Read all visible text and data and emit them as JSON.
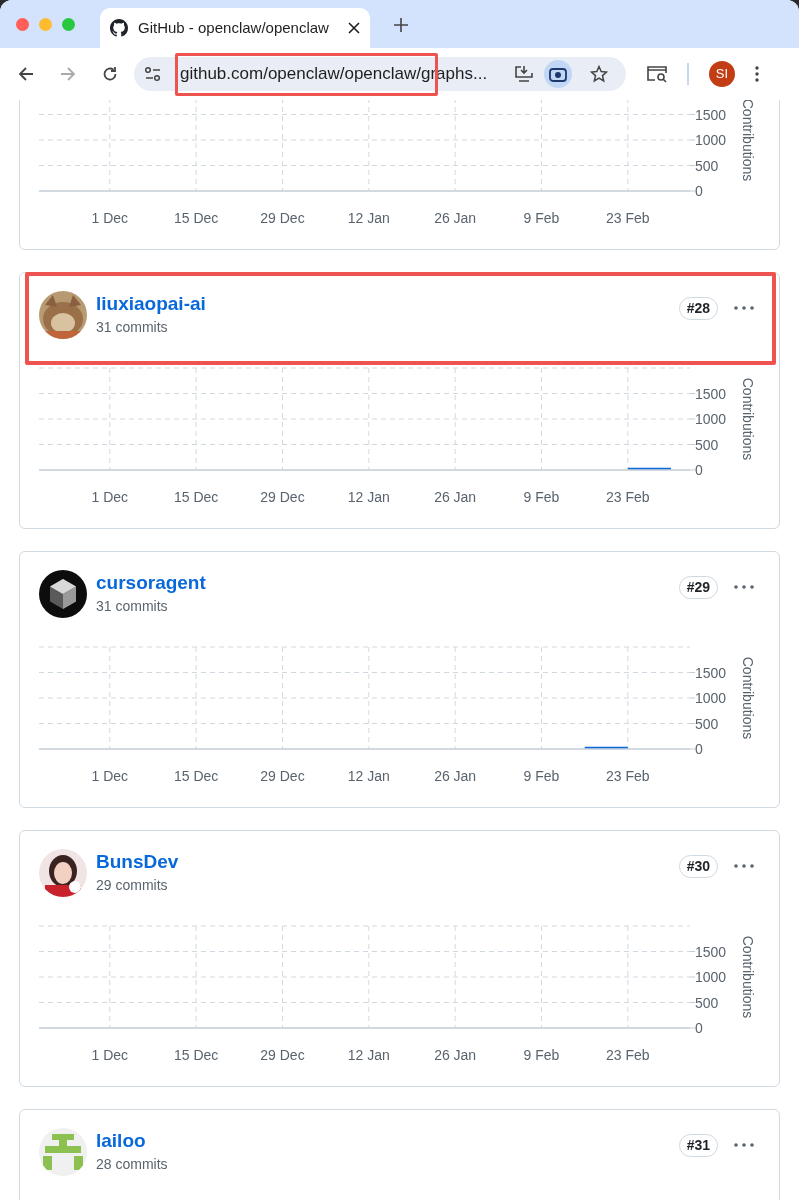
{
  "browser": {
    "tab_title": "GitHub - openclaw/openclaw",
    "url": "github.com/openclaw/openclaw/graphs...",
    "url_highlighted": true,
    "profile": "SI"
  },
  "contributors": [
    {
      "highlighted": false,
      "chart_data": {
        "type": "line",
        "ylabel": "Contributions",
        "grid": true,
        "ylim": [
          0,
          2000
        ],
        "categories": [
          null,
          "1 Dec",
          null,
          "15 Dec",
          null,
          "29 Dec",
          null,
          "12 Jan",
          null,
          "26 Jan",
          null,
          "9 Feb",
          null,
          "23 Feb",
          null
        ],
        "yticks": [
          0,
          500,
          1000,
          1500
        ]
      }
    },
    {
      "name": "liuxiaopai-ai",
      "commits": "31 commits",
      "rank": "#28",
      "highlighted": true,
      "chart_data": {
        "type": "line",
        "ylabel": "Contributions",
        "grid": true,
        "ylim": [
          0,
          2000
        ],
        "categories": [
          null,
          "1 Dec",
          null,
          "15 Dec",
          null,
          "29 Dec",
          null,
          "12 Jan",
          null,
          "26 Jan",
          null,
          "9 Feb",
          null,
          "23 Feb",
          null
        ],
        "yticks": [
          0,
          500,
          1000,
          1500
        ],
        "series": [
          {
            "color": "#0969da",
            "values": [
              null,
              null,
              null,
              null,
              null,
              null,
              null,
              null,
              null,
              null,
              null,
              null,
              null,
              10,
              10
            ]
          }
        ]
      }
    },
    {
      "name": "cursoragent",
      "commits": "31 commits",
      "rank": "#29",
      "kind": "logo",
      "highlighted": false,
      "chart_data": {
        "type": "line",
        "ylabel": "Contributions",
        "grid": true,
        "ylim": [
          0,
          2000
        ],
        "categories": [
          null,
          "1 Dec",
          null,
          "15 Dec",
          null,
          "29 Dec",
          null,
          "12 Jan",
          null,
          "26 Jan",
          null,
          "9 Feb",
          null,
          "23 Feb",
          null
        ],
        "yticks": [
          0,
          500,
          1000,
          1500
        ],
        "series": [
          {
            "color": "#0969da",
            "values": [
              null,
              null,
              null,
              null,
              null,
              null,
              null,
              null,
              null,
              null,
              null,
              null,
              10,
              10,
              null
            ]
          }
        ]
      }
    },
    {
      "name": "BunsDev",
      "commits": "29 commits",
      "rank": "#30",
      "highlighted": false,
      "chart_data": {
        "type": "line",
        "ylabel": "Contributions",
        "grid": true,
        "ylim": [
          0,
          2000
        ],
        "categories": [
          null,
          "1 Dec",
          null,
          "15 Dec",
          null,
          "29 Dec",
          null,
          "12 Jan",
          null,
          "26 Jan",
          null,
          "9 Feb",
          null,
          "23 Feb",
          null
        ],
        "yticks": [
          0,
          500,
          1000,
          1500
        ]
      }
    },
    {
      "name": "lailoo",
      "commits": "28 commits",
      "rank": "#31",
      "kind": "identicon",
      "highlighted": false
    }
  ]
}
